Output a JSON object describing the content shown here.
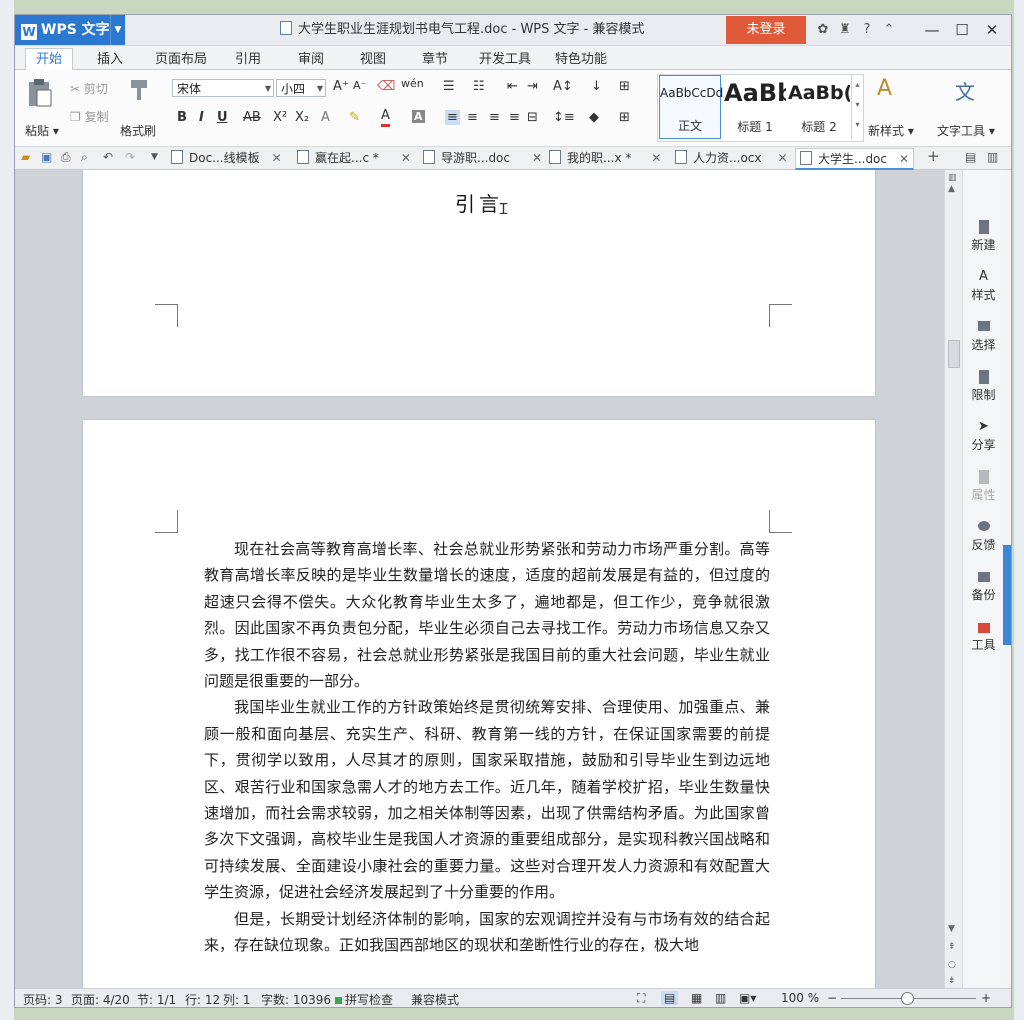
{
  "app": {
    "logo_label": "WPS 文字",
    "window_title": "大学生职业生涯规划书电气工程.doc - WPS 文字 - 兼容模式",
    "login_button": "未登录"
  },
  "menu": {
    "tabs": [
      "开始",
      "插入",
      "页面布局",
      "引用",
      "审阅",
      "视图",
      "章节",
      "开发工具",
      "特色功能"
    ],
    "active_tab": "开始"
  },
  "ribbon": {
    "paste_label": "粘贴",
    "cut_label": "剪切",
    "copy_label": "复制",
    "format_painter_label": "格式刷",
    "font_name": "宋体",
    "font_size": "小四",
    "styles": [
      {
        "preview": "AaBbCcDd",
        "label": "正文"
      },
      {
        "preview": "AaBb",
        "label": "标题 1"
      },
      {
        "preview": "AaBb(",
        "label": "标题 2"
      }
    ],
    "new_style_label": "新样式",
    "text_tools_label": "文字工具"
  },
  "doc_tabs": [
    {
      "title": "Doc...线模板",
      "active": false
    },
    {
      "title": "赢在起...c *",
      "active": false
    },
    {
      "title": "导游职...doc",
      "active": false
    },
    {
      "title": "我的职...x *",
      "active": false
    },
    {
      "title": "人力资...ocx",
      "active": false
    },
    {
      "title": "大学生...doc",
      "active": true
    }
  ],
  "document": {
    "heading": "引言",
    "paragraphs": [
      "现在社会高等教育高增长率、社会总就业形势紧张和劳动力市场严重分割。高等教育高增长率反映的是毕业生数量增长的速度，适度的超前发展是有益的，但过度的超速只会得不偿失。大众化教育毕业生太多了，遍地都是，但工作少，竞争就很激烈。因此国家不再负责包分配，毕业生必须自己去寻找工作。劳动力市场信息又杂又多，找工作很不容易，社会总就业形势紧张是我国目前的重大社会问题，毕业生就业问题是很重要的一部分。",
      "我国毕业生就业工作的方针政策始终是贯彻统筹安排、合理使用、加强重点、兼顾一般和面向基层、充实生产、科研、教育第一线的方针，在保证国家需要的前提下，贯彻学以致用，人尽其才的原则，国家采取措施，鼓励和引导毕业生到边远地区、艰苦行业和国家急需人才的地方去工作。近几年，随着学校扩招，毕业生数量快速增加，而社会需求较弱，加之相关体制等因素，出现了供需结构矛盾。为此国家曾多次下文强调，高校毕业生是我国人才资源的重要组成部分，是实现科教兴国战略和可持续发展、全面建设小康社会的重要力量。这些对合理开发人力资源和有效配置大学生资源，促进社会经济发展起到了十分重要的作用。",
      "但是，长期受计划经济体制的影响，国家的宏观调控并没有与市场有效的结合起来，存在缺位现象。正如我国西部地区的现状和垄断性行业的存在，极大地"
    ]
  },
  "side_panel": [
    {
      "label": "新建",
      "icon": "new-doc-icon",
      "enabled": true
    },
    {
      "label": "样式",
      "icon": "style-icon",
      "enabled": true
    },
    {
      "label": "选择",
      "icon": "select-icon",
      "enabled": true
    },
    {
      "label": "限制",
      "icon": "restrict-icon",
      "enabled": true
    },
    {
      "label": "分享",
      "icon": "share-icon",
      "enabled": true
    },
    {
      "label": "属性",
      "icon": "properties-icon",
      "enabled": false
    },
    {
      "label": "反馈",
      "icon": "feedback-icon",
      "enabled": true
    },
    {
      "label": "备份",
      "icon": "backup-icon",
      "enabled": true
    },
    {
      "label": "工具",
      "icon": "toolbox-icon",
      "enabled": true
    }
  ],
  "status": {
    "page_code": "页码: 3",
    "pages": "页面: 4/20",
    "section": "节: 1/1",
    "row": "行: 12",
    "col": "列: 1",
    "word_count": "字数: 10396",
    "spell_check": "拼写检查",
    "compat_mode": "兼容模式",
    "zoom": "100 %"
  },
  "colors": {
    "accent_blue": "#2b78d0",
    "login_orange": "#e05a39"
  }
}
